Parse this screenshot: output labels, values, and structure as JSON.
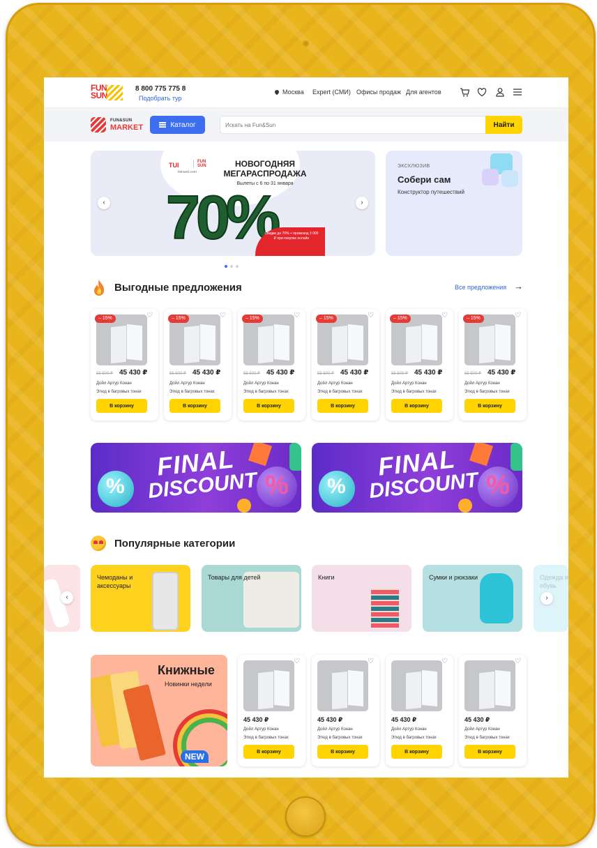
{
  "header": {
    "logo_text": "FUN SUN",
    "phone": "8 800 775 775 8",
    "pick_tour": "Подобрать тур",
    "city": "Москва",
    "nav": [
      "Expert (СМИ)",
      "Офисы продаж",
      "Для агентов"
    ],
    "icons": [
      "cart-icon",
      "heart-icon",
      "user-icon",
      "menu-icon"
    ]
  },
  "market": {
    "logo_small": "FUN&SUN",
    "logo_big": "MARKET",
    "catalog": "Каталог",
    "search_placeholder": "Искать на Fun&Sun",
    "search_button": "Найти"
  },
  "hero": {
    "partner": "TUI",
    "partner2": "FUN SUN",
    "partner_url": "fstravel.com",
    "title": "НОВОГОДНЯЯ МЕГАРАСПРОДАЖА",
    "dates": "Вылеты с 6 по 31 января",
    "big": "70%",
    "tag": "Скидки до 70% + промокод 3 000 ₽ при покупке онлайн",
    "slides": 3,
    "active_slide": 1
  },
  "exclusive": {
    "kicker": "ЭКСКЛЮЗИВ",
    "title": "Собери сам",
    "subtitle": "Конструктор путешествий"
  },
  "deals": {
    "title": "Выгодные предложения",
    "all_link": "Все предложения",
    "items": [
      {
        "discount": "– 15%",
        "old": "55 500 ₽",
        "price": "45 430 ₽",
        "name1": "Дойл Артур Конан",
        "name2": "Этюд в багровых тонах",
        "button": "В корзину"
      },
      {
        "discount": "– 15%",
        "old": "55 500 ₽",
        "price": "45 430 ₽",
        "name1": "Дойл Артур Конан",
        "name2": "Этюд в багровых тонах",
        "button": "В корзину"
      },
      {
        "discount": "– 15%",
        "old": "55 500 ₽",
        "price": "45 430 ₽",
        "name1": "Дойл Артур Конан",
        "name2": "Этюд в багровых тонах",
        "button": "В корзину"
      },
      {
        "discount": "– 15%",
        "old": "55 500 ₽",
        "price": "45 430 ₽",
        "name1": "Дойл Артур Конан",
        "name2": "Этюд в багровых тонах",
        "button": "В корзину"
      },
      {
        "discount": "– 15%",
        "old": "55 500 ₽",
        "price": "45 430 ₽",
        "name1": "Дойл Артур Конан",
        "name2": "Этюд в багровых тонах",
        "button": "В корзину"
      },
      {
        "discount": "– 15%",
        "old": "55 500 ₽",
        "price": "45 430 ₽",
        "name1": "Дойл Артур Конан",
        "name2": "Этюд в багровых тонах",
        "button": "В корзину"
      }
    ]
  },
  "promos": [
    {
      "line1": "FINAL",
      "line2": "DISCOUNT"
    },
    {
      "line1": "FINAL",
      "line2": "DISCOUNT"
    }
  ],
  "categories": {
    "title": "Популярные категории",
    "items": [
      {
        "label": "Чемоданы и аксессуары",
        "bg": "#ffd21f"
      },
      {
        "label": "Товары для детей",
        "bg": "#a9d8d5"
      },
      {
        "label": "Книги",
        "bg": "#f4dfe8"
      },
      {
        "label": "Сумки и рюкзаки",
        "bg": "#b5dfe0"
      },
      {
        "label": "Одежда и обувь",
        "bg": "#def4fb"
      }
    ]
  },
  "books": {
    "title": "Книжные",
    "subtitle": "Новинки недели",
    "badge": "NEW",
    "items": [
      {
        "price": "45 430 ₽",
        "name1": "Дойл Артур Конан",
        "name2": "Этюд в багровых тонах",
        "button": "В корзину"
      },
      {
        "price": "45 430 ₽",
        "name1": "Дойл Артур Конан",
        "name2": "Этюд в багровых тонах",
        "button": "В корзину"
      },
      {
        "price": "45 430 ₽",
        "name1": "Дойл Артур Конан",
        "name2": "Этюд в багровых тонах",
        "button": "В корзину"
      },
      {
        "price": "45 430 ₽",
        "name1": "Дойл Артур Конан",
        "name2": "Этюд в багровых тонах",
        "button": "В корзину"
      }
    ]
  },
  "colors": {
    "frame": "#e9b51c",
    "accent_blue": "#3d6ef0",
    "accent_yellow": "#ffd400",
    "discount_red": "#e53a35"
  }
}
